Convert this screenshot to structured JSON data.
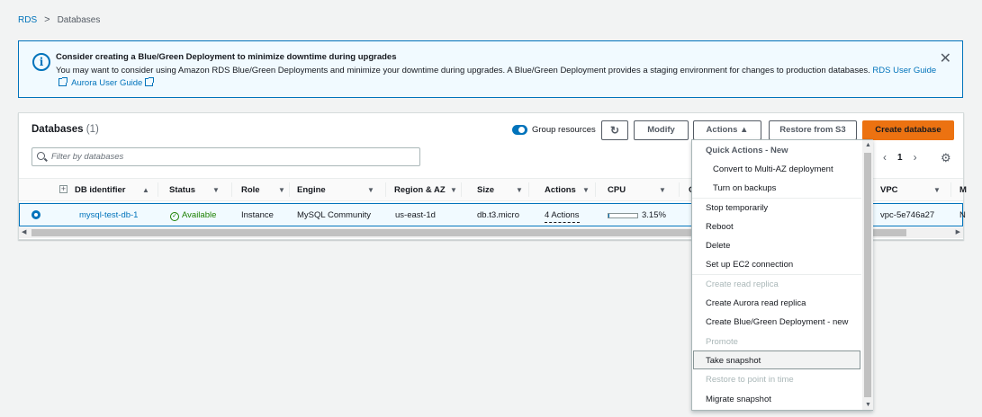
{
  "breadcrumb": {
    "root": "RDS",
    "separator": ">",
    "current": "Databases"
  },
  "banner": {
    "title": "Consider creating a Blue/Green Deployment to minimize downtime during upgrades",
    "text": "You may want to consider using Amazon RDS Blue/Green Deployments and minimize your downtime during upgrades. A Blue/Green Deployment provides a staging environment for changes to production databases.",
    "link1": "RDS User Guide",
    "link2": "Aurora User Guide",
    "close": "✕"
  },
  "panel": {
    "title": "Databases",
    "count": "(1)",
    "group_label": "Group resources",
    "refresh": "↻",
    "modify": "Modify",
    "actions": "Actions ▲",
    "restore": "Restore from S3",
    "create": "Create database",
    "filter_placeholder": "Filter by databases",
    "page": "1",
    "prev": "‹",
    "next": "›",
    "gear": "⚙"
  },
  "columns": [
    "DB identifier",
    "Status",
    "Role",
    "Engine",
    "Region & AZ",
    "Size",
    "Actions",
    "CPU",
    "C",
    "VPC",
    "M"
  ],
  "row": {
    "id": "mysql-test-db-1",
    "status": "Available",
    "role": "Instance",
    "engine": "MySQL Community",
    "region": "us-east-1d",
    "size": "db.t3.micro",
    "actions": "4 Actions",
    "cpu": "3.15%",
    "cpu_fraction": 0.0315,
    "vpc": "vpc-5e746a27",
    "m": "N"
  },
  "menu": {
    "quick_header": "Quick Actions - New",
    "quick1": "Convert to Multi-AZ deployment",
    "quick2": "Turn on backups",
    "stop": "Stop temporarily",
    "reboot": "Reboot",
    "delete": "Delete",
    "ec2": "Set up EC2 connection",
    "read_replica": "Create read replica",
    "aurora_replica": "Create Aurora read replica",
    "bluegreen": "Create Blue/Green Deployment - new",
    "promote": "Promote",
    "snapshot": "Take snapshot",
    "restore_pit": "Restore to point in time",
    "migrate": "Migrate snapshot"
  },
  "colors": {
    "accent": "#0073bb",
    "primary_button": "#ec7211",
    "success": "#1d8102"
  },
  "icons": {
    "info": "info-icon",
    "close": "close-icon",
    "refresh": "refresh-icon",
    "search": "search-icon",
    "settings": "gear-icon"
  }
}
